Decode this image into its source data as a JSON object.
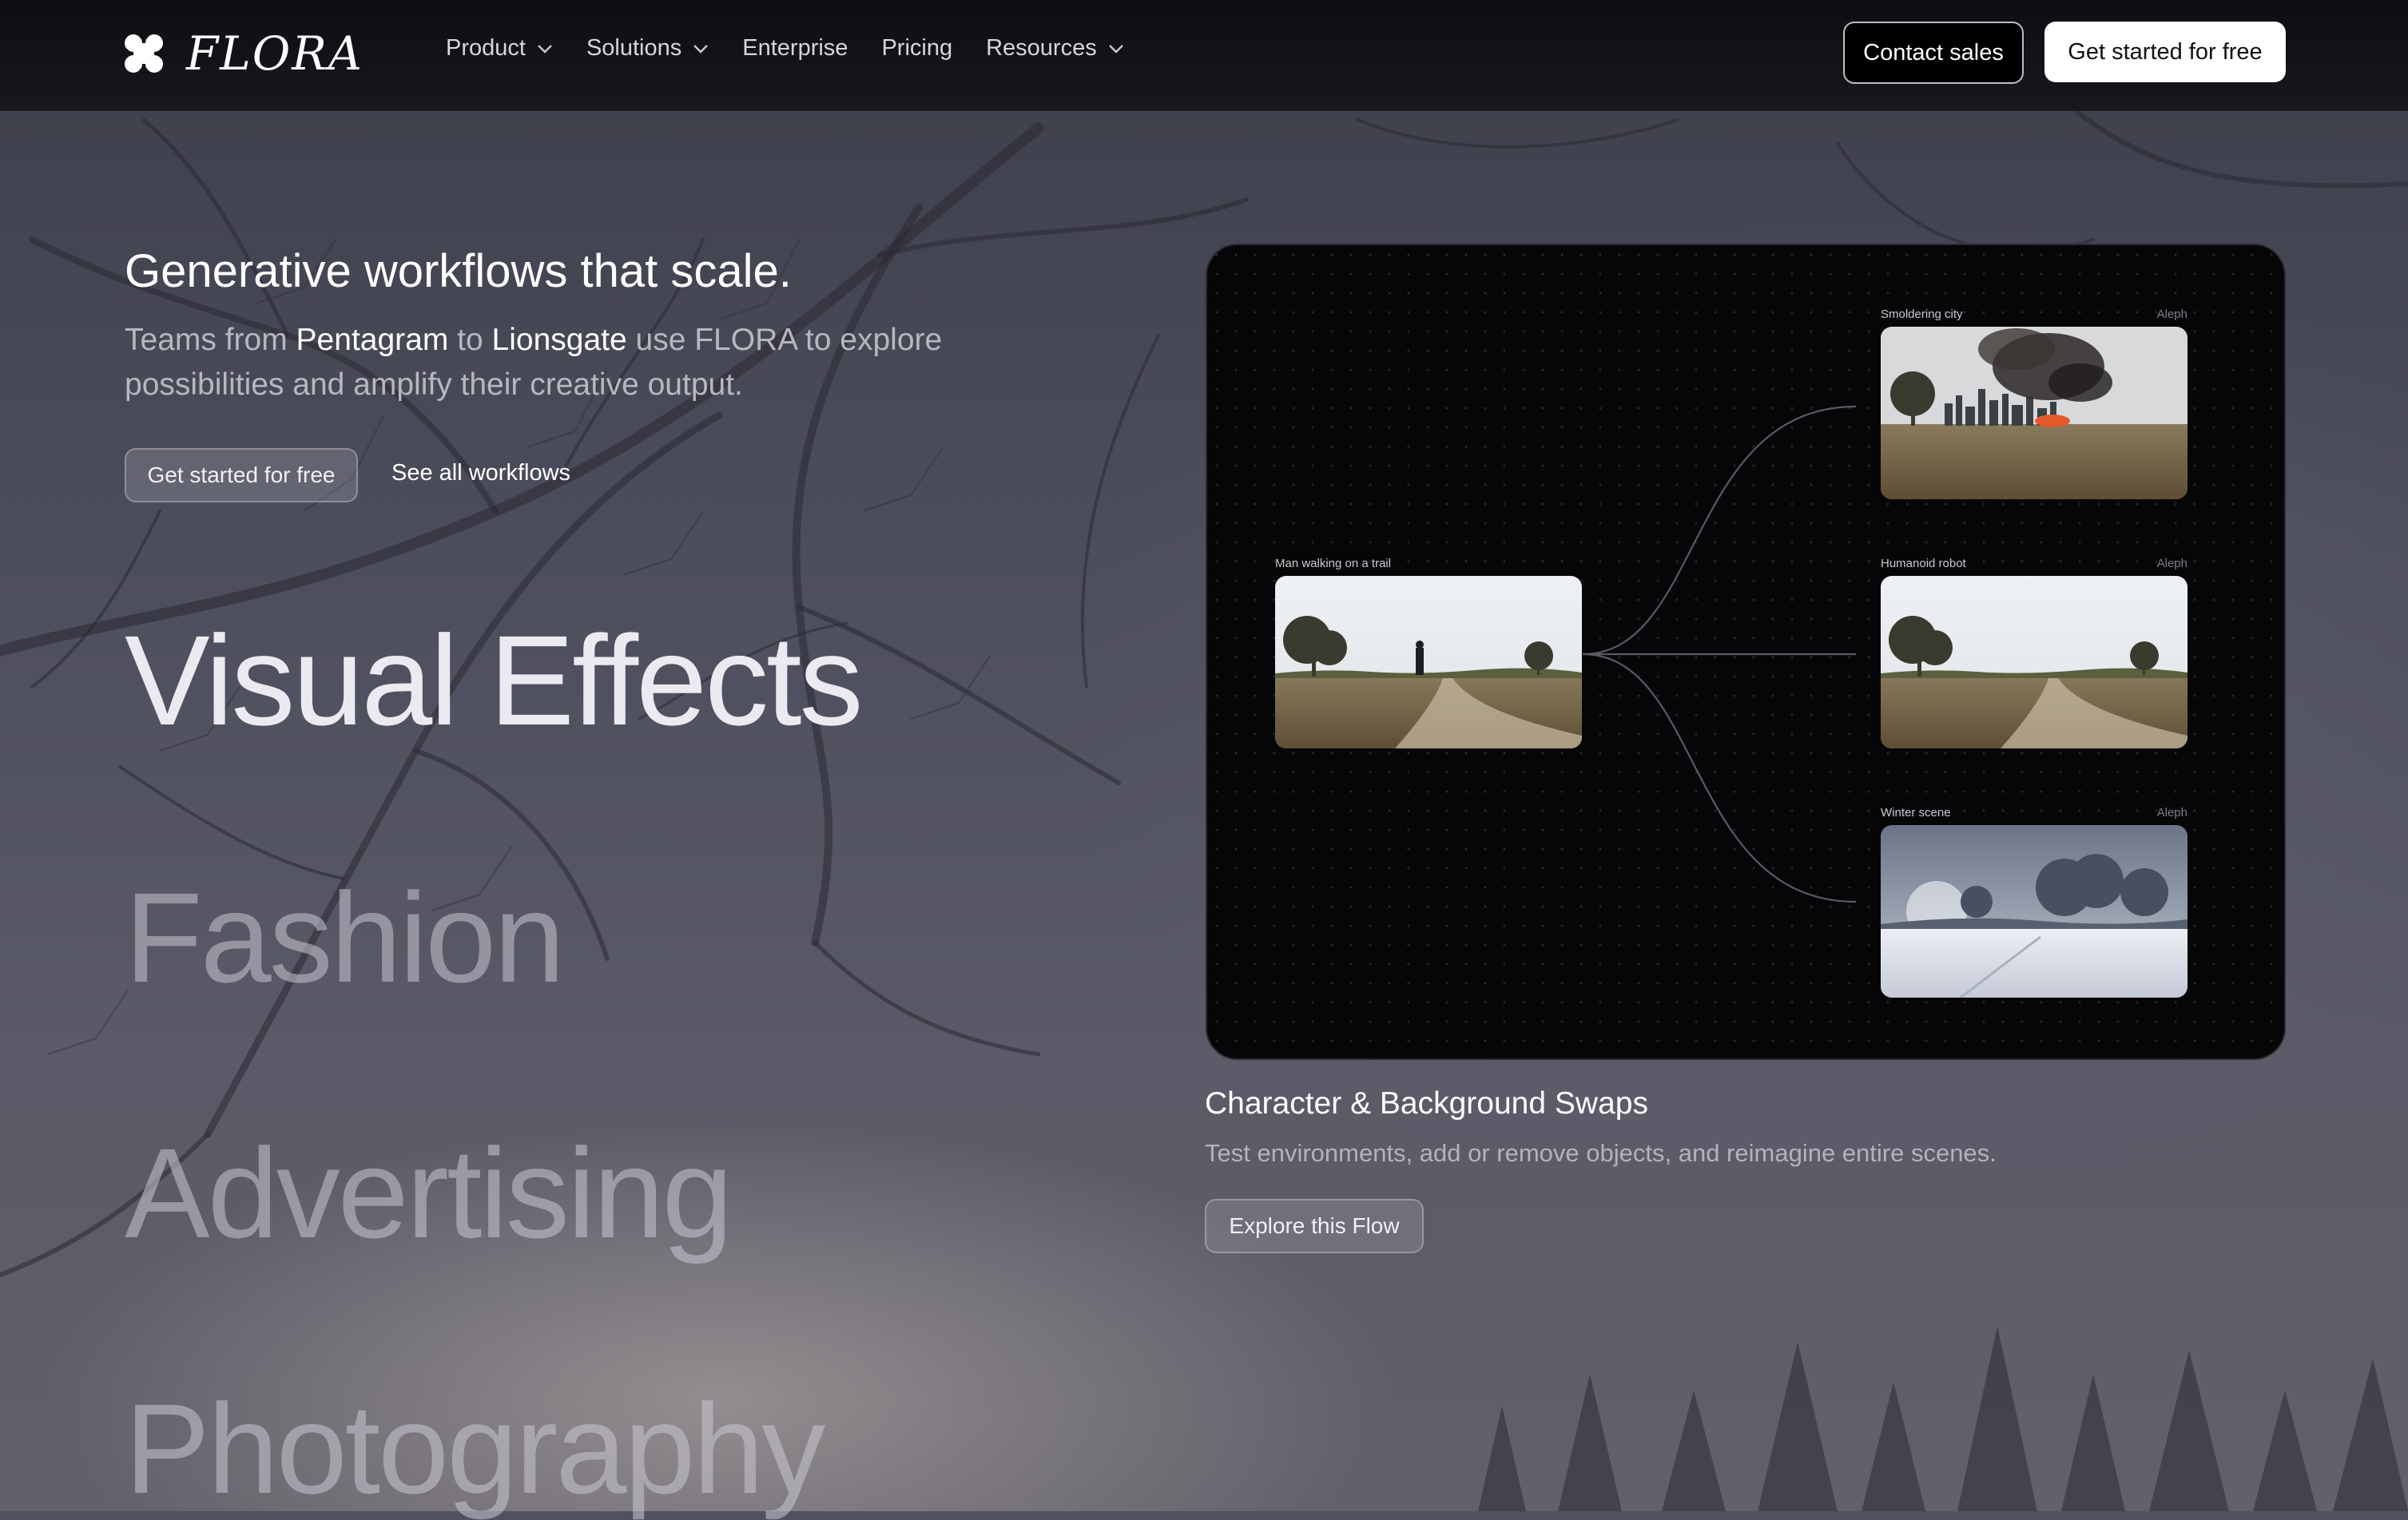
{
  "nav": {
    "brand": "FLORA",
    "menu": [
      {
        "label": "Product",
        "dropdown": true
      },
      {
        "label": "Solutions",
        "dropdown": true
      },
      {
        "label": "Enterprise",
        "dropdown": false
      },
      {
        "label": "Pricing",
        "dropdown": false
      },
      {
        "label": "Resources",
        "dropdown": true
      }
    ],
    "contact_label": "Contact sales",
    "start_label": "Get started for free"
  },
  "hero": {
    "title": "Generative workflows that scale.",
    "sub_part1": "Teams from ",
    "sub_brand1": "Pentagram",
    "sub_part2": " to ",
    "sub_brand2": "Lionsgate",
    "sub_part3": " use FLORA to explore possibilities and amplify their creative output.",
    "primary_label": "Get started for free",
    "link_label": "See all workflows"
  },
  "categories": [
    "Visual Effects",
    "Fashion",
    "Advertising",
    "Photography"
  ],
  "workflow": {
    "source": {
      "label": "Man walking on a trail"
    },
    "outputs": [
      {
        "label": "Smoldering city",
        "model": "Aleph"
      },
      {
        "label": "Humanoid robot",
        "model": "Aleph"
      },
      {
        "label": "Winter scene",
        "model": "Aleph"
      }
    ],
    "title": "Character & Background Swaps",
    "description": "Test environments, add or remove objects, and reimagine entire scenes.",
    "cta_label": "Explore this Flow"
  },
  "colors": {
    "nav_bg": "#111116",
    "canvas_bg": "#060608",
    "accent_text": "#ffffff",
    "muted_text": "#b7b7c0"
  },
  "icons": {
    "logo": "flora-logo-icon",
    "dropdown": "chevron-down-icon"
  }
}
